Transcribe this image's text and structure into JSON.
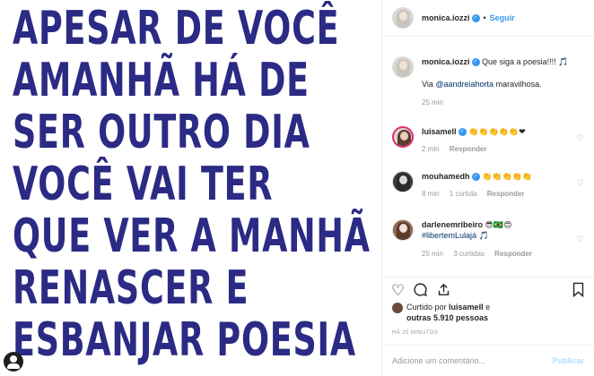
{
  "post_image": {
    "lines": [
      "APESAR DE VOCÊ",
      "AMANHÃ HÁ DE",
      "SER OUTRO DIA",
      "VOCÊ VAI TER",
      "QUE VER A MANHÃ",
      "RENASCER E",
      "ESBANJAR POESIA"
    ],
    "text_color": "#2b2a84"
  },
  "header": {
    "username": "monica.iozzi",
    "separator": "•",
    "follow_label": "Seguir"
  },
  "caption": {
    "username": "monica.iozzi",
    "text": "Que siga a poesia!!!! 🎵",
    "via_prefix": "Via",
    "via_mention": "@aandreiahorta",
    "via_suffix": "maravilhosa.",
    "time": "25 min"
  },
  "comments": [
    {
      "username": "luisamell",
      "text": "👏👏👏👏👏❤",
      "time": "2 min",
      "likes": "",
      "reply_label": "Responder"
    },
    {
      "username": "mouhamedh",
      "text": "👏👏👏👏👏",
      "time": "8 min",
      "likes": "1 curtida",
      "reply_label": "Responder"
    },
    {
      "username": "darlenemribeiro",
      "text": "😎🇧🇷😍",
      "hashtag": "#libertemLulajá 🎵",
      "time": "25 min",
      "likes": "3 curtidas",
      "reply_label": "Responder"
    }
  ],
  "likes": {
    "prefix": "Curtido por",
    "user": "luisamell",
    "middle": "e",
    "count_text": "outras 5.910 pessoas"
  },
  "timestamp": "Há 25 minutos",
  "add_comment": {
    "placeholder": "Adicione um comentário...",
    "publish_label": "Publicar"
  },
  "icons": {
    "like": "heart-icon",
    "comment": "comment-icon",
    "share": "share-icon",
    "save": "bookmark-icon",
    "verified": "verified-badge-icon"
  },
  "colors": {
    "accent": "#3897f0",
    "poem": "#2b2a84",
    "muted": "#999999"
  }
}
